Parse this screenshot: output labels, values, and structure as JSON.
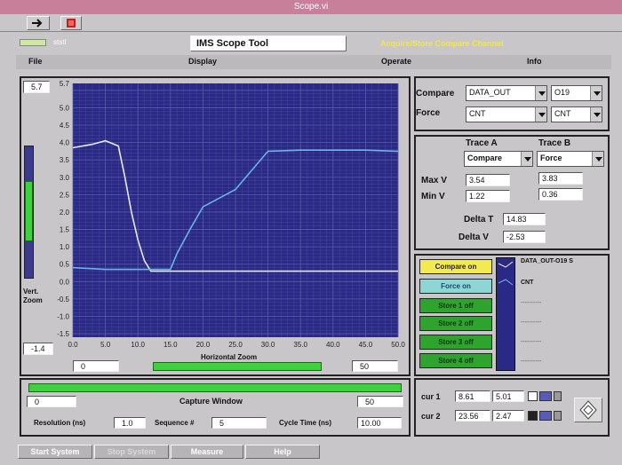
{
  "window": {
    "title": "Scope.vi"
  },
  "header": {
    "indicator": "ststl",
    "app_title": "IMS Scope Tool",
    "status_text": "Acquire/Store Compare Channel"
  },
  "menu": {
    "file": "File",
    "display": "Display",
    "operate": "Operate",
    "info": "Info"
  },
  "scope": {
    "y_max_label": "5.7",
    "y_min_label": "-1.4",
    "vert_zoom_label": "Vert.\nZoom",
    "horiz_zoom_label": "Horizontal Zoom",
    "x_min_label": "0",
    "x_max_label": "50"
  },
  "compare_force": {
    "compare_label": "Compare",
    "force_label": "Force",
    "compare_channel": "DATA_OUT",
    "compare_value": "O19",
    "force_channel": "CNT",
    "force_value": "CNT"
  },
  "measurements": {
    "trace_a_label": "Trace A",
    "trace_b_label": "Trace B",
    "trace_a_select": "Compare",
    "trace_b_select": "Force",
    "max_v_label": "Max V",
    "min_v_label": "Min V",
    "max_v_a": "3.54",
    "max_v_b": "3.83",
    "min_v_a": "1.22",
    "min_v_b": "0.36",
    "delta_t_label": "Delta T",
    "delta_t": "14.83",
    "delta_v_label": "Delta V",
    "delta_v": "-2.53"
  },
  "legend": {
    "compare_on": "Compare on",
    "force_on": "Force on",
    "store1": "Store 1 off",
    "store2": "Store 2 off",
    "store3": "Store 3 off",
    "store4": "Store 4 off",
    "trace1_name": "DATA_OUT-O19 S",
    "trace2_name": "CNT",
    "empty1": "----------",
    "empty2": "----------",
    "empty3": "----------",
    "empty4": "----------"
  },
  "capture": {
    "title": "Capture Window",
    "left_value": "0",
    "right_value": "50",
    "resolution_label": "Resolution  (ns)",
    "resolution": "1.0",
    "sequence_label": "Sequence #",
    "sequence": "5",
    "cycle_time_label": "Cycle Time (ns)",
    "cycle_time": "10.00"
  },
  "cursors": {
    "cur1_label": "cur 1",
    "cur1_x": "8.61",
    "cur1_y": "5.01",
    "cur2_label": "cur 2",
    "cur2_x": "23.56",
    "cur2_y": "2.47"
  },
  "bottom_buttons": {
    "start": "Start System",
    "stop": "Stop System",
    "measure": "Measure",
    "help": "Help"
  },
  "colors": {
    "plot_bg": "#2a2a86",
    "grid": "#5a5aaa",
    "trace_compare": "#e8e8f0",
    "trace_force": "#6ab4e6",
    "accent_green": "#2ea32e",
    "yellow": "#f2ea50",
    "cyan": "#8ed6d6"
  },
  "chart_data": {
    "type": "line",
    "xlim": [
      0,
      50
    ],
    "ylim": [
      -1.6,
      5.7
    ],
    "x_ticks": [
      0,
      5,
      10,
      15,
      20,
      25,
      30,
      35,
      40,
      45,
      50
    ],
    "y_ticks": [
      5.7,
      5.0,
      4.5,
      4.0,
      3.5,
      3.0,
      2.5,
      2.0,
      1.5,
      1.0,
      0.5,
      0.0,
      -0.5,
      -1.0,
      -1.5
    ],
    "x_tick_labels": [
      "0.0",
      "5.0",
      "10.0",
      "15.0",
      "20.0",
      "25.0",
      "30.0",
      "35.0",
      "40.0",
      "45.0",
      "50.0"
    ],
    "y_tick_labels": [
      "5.7",
      "5.0",
      "4.5",
      "4.0",
      "3.5",
      "3.0",
      "2.5",
      "2.0",
      "1.5",
      "1.0",
      "0.5",
      "0.0",
      "-0.5",
      "-1.0",
      "-1.5"
    ],
    "series": [
      {
        "name": "DATA_OUT-O19 S",
        "color": "#e8e8f0",
        "x": [
          0,
          3,
          5,
          7,
          8,
          9,
          10,
          11,
          12,
          15,
          20,
          30,
          40,
          50
        ],
        "y": [
          3.85,
          3.95,
          4.05,
          3.9,
          3.0,
          2.0,
          1.2,
          0.6,
          0.3,
          0.3,
          0.3,
          0.3,
          0.3,
          0.3
        ]
      },
      {
        "name": "CNT",
        "color": "#6ab4e6",
        "x": [
          0,
          5,
          10,
          15,
          16,
          18,
          20,
          25,
          30,
          35,
          40,
          45,
          50
        ],
        "y": [
          0.4,
          0.35,
          0.35,
          0.35,
          0.8,
          1.5,
          2.15,
          2.65,
          3.75,
          3.78,
          3.78,
          3.78,
          3.75
        ]
      }
    ]
  }
}
